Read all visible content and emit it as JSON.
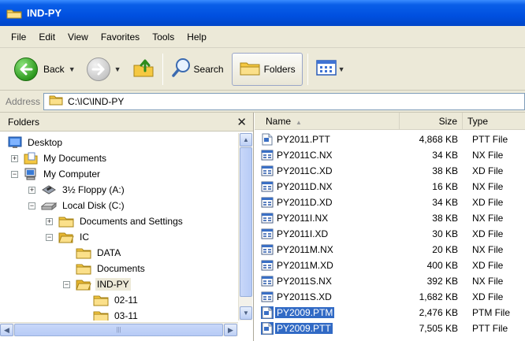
{
  "window": {
    "title": "IND-PY"
  },
  "menu": [
    "File",
    "Edit",
    "View",
    "Favorites",
    "Tools",
    "Help"
  ],
  "toolbar": {
    "back_label": "Back",
    "search_label": "Search",
    "folders_label": "Folders"
  },
  "address": {
    "label": "Address",
    "value": "C:\\IC\\IND-PY"
  },
  "folders_pane": {
    "title": "Folders",
    "close_glyph": "✕",
    "tree": [
      {
        "label": "Desktop",
        "icon": "desktop-icon",
        "expander": ""
      },
      {
        "label": "My Documents",
        "icon": "my-documents-icon",
        "expander": "+"
      },
      {
        "label": "My Computer",
        "icon": "my-computer-icon",
        "expander": "−"
      },
      {
        "label": "3½ Floppy (A:)",
        "icon": "floppy-drive-icon",
        "expander": "+"
      },
      {
        "label": "Local Disk (C:)",
        "icon": "hard-drive-icon",
        "expander": "−"
      },
      {
        "label": "Documents and Settings",
        "icon": "folder-icon",
        "expander": "+"
      },
      {
        "label": "IC",
        "icon": "open-folder-icon",
        "expander": "−"
      },
      {
        "label": "DATA",
        "icon": "folder-icon",
        "expander": ""
      },
      {
        "label": "Documents",
        "icon": "folder-icon",
        "expander": ""
      },
      {
        "label": "IND-PY",
        "icon": "open-folder-icon",
        "expander": "−",
        "selected": true
      },
      {
        "label": "02-11",
        "icon": "folder-icon",
        "expander": ""
      },
      {
        "label": "03-11",
        "icon": "folder-icon",
        "expander": ""
      }
    ]
  },
  "file_list": {
    "columns": {
      "name": "Name",
      "size": "Size",
      "type": "Type"
    },
    "files": [
      {
        "name": "PY2011.PTT",
        "size": "4,868 KB",
        "type": "PTT File",
        "icon": "ptt-file-icon",
        "selected": false
      },
      {
        "name": "PY2011C.NX",
        "size": "34 KB",
        "type": "NX File",
        "icon": "data-file-icon",
        "selected": false
      },
      {
        "name": "PY2011C.XD",
        "size": "38 KB",
        "type": "XD File",
        "icon": "data-file-icon",
        "selected": false
      },
      {
        "name": "PY2011D.NX",
        "size": "16 KB",
        "type": "NX File",
        "icon": "data-file-icon",
        "selected": false
      },
      {
        "name": "PY2011D.XD",
        "size": "34 KB",
        "type": "XD File",
        "icon": "data-file-icon",
        "selected": false
      },
      {
        "name": "PY2011I.NX",
        "size": "38 KB",
        "type": "NX File",
        "icon": "data-file-icon",
        "selected": false
      },
      {
        "name": "PY2011I.XD",
        "size": "30 KB",
        "type": "XD File",
        "icon": "data-file-icon",
        "selected": false
      },
      {
        "name": "PY2011M.NX",
        "size": "20 KB",
        "type": "NX File",
        "icon": "data-file-icon",
        "selected": false
      },
      {
        "name": "PY2011M.XD",
        "size": "400 KB",
        "type": "XD File",
        "icon": "data-file-icon",
        "selected": false
      },
      {
        "name": "PY2011S.NX",
        "size": "392 KB",
        "type": "NX File",
        "icon": "data-file-icon",
        "selected": false
      },
      {
        "name": "PY2011S.XD",
        "size": "1,682 KB",
        "type": "XD File",
        "icon": "data-file-icon",
        "selected": false
      },
      {
        "name": "PY2009.PTM",
        "size": "2,476 KB",
        "type": "PTM File",
        "icon": "ptm-file-icon",
        "selected": true
      },
      {
        "name": "PY2009.PTT",
        "size": "7,505 KB",
        "type": "PTT File",
        "icon": "ptt-file-icon",
        "selected": true
      }
    ]
  },
  "colors": {
    "titlebar": "#0050e0",
    "chrome": "#ece9d8",
    "selection": "#316ac5"
  }
}
